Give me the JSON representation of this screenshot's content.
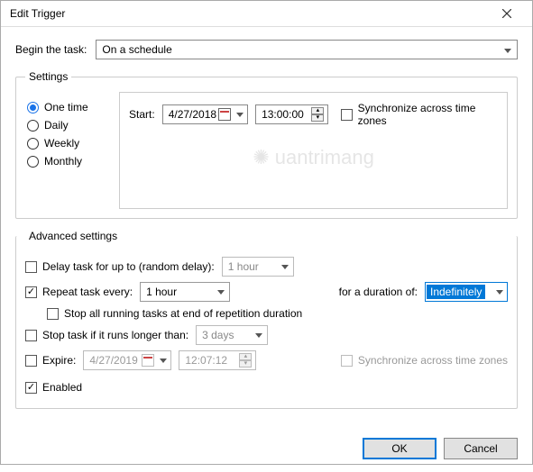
{
  "window": {
    "title": "Edit Trigger"
  },
  "begin": {
    "label": "Begin the task:",
    "value": "On a schedule"
  },
  "settings": {
    "legend": "Settings",
    "freq": {
      "one_time": "One time",
      "daily": "Daily",
      "weekly": "Weekly",
      "monthly": "Monthly"
    },
    "start_label": "Start:",
    "date": "4/27/2018",
    "time": "13:00:00",
    "sync_label": "Synchronize across time zones"
  },
  "advanced": {
    "legend": "Advanced settings",
    "delay_label": "Delay task for up to (random delay):",
    "delay_value": "1 hour",
    "repeat_label": "Repeat task every:",
    "repeat_value": "1 hour",
    "duration_label": "for a duration of:",
    "duration_value": "Indefinitely",
    "stop_rep_label": "Stop all running tasks at end of repetition duration",
    "stop_long_label": "Stop task if it runs longer than:",
    "stop_long_value": "3 days",
    "expire_label": "Expire:",
    "expire_date": "4/27/2019",
    "expire_time": "12:07:12",
    "expire_sync": "Synchronize across time zones",
    "enabled_label": "Enabled"
  },
  "footer": {
    "ok": "OK",
    "cancel": "Cancel"
  }
}
